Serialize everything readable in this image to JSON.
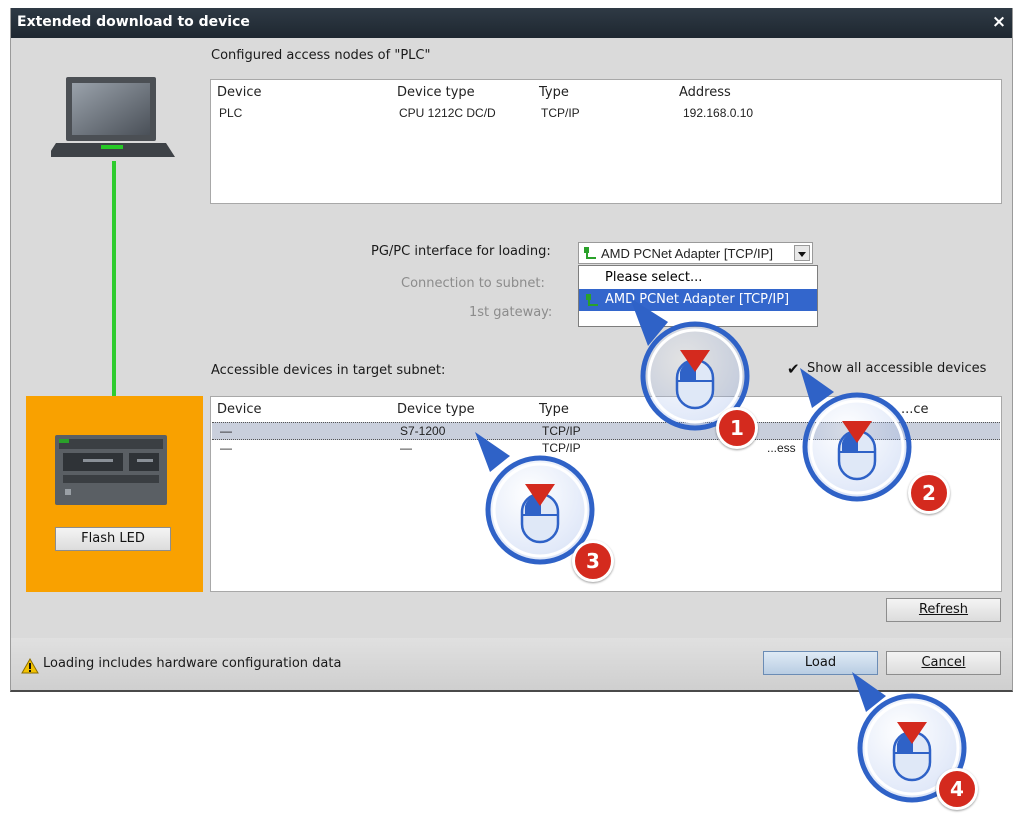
{
  "dialog": {
    "title": "Extended download to device",
    "close_glyph": "×"
  },
  "configured": {
    "heading": "Configured access nodes of \"PLC\"",
    "columns": [
      "Device",
      "Device type",
      "Type",
      "Address"
    ],
    "rows": [
      {
        "device": "PLC",
        "device_type": "CPU 1212C DC/D",
        "type": "TCP/IP",
        "address": "192.168.0.10"
      }
    ]
  },
  "interface": {
    "pgpc_label": "PG/PC interface for loading:",
    "subnet_label": "Connection to subnet:",
    "gateway_label": "1st gateway:",
    "selected": "AMD PCNet Adapter [TCP/IP]",
    "options": [
      "Please select...",
      "AMD PCNet Adapter [TCP/IP]"
    ]
  },
  "accessible": {
    "heading": "Accessible devices in target subnet:",
    "show_all_label": "Show all accessible devices",
    "show_all_checked": true,
    "columns": [
      "Device",
      "Device type",
      "Type",
      "...ce"
    ],
    "rows": [
      {
        "device": "—",
        "device_type": "S7-1200",
        "type": "TCP/IP",
        "address": ""
      },
      {
        "device": "—",
        "device_type": "—",
        "type": "TCP/IP",
        "address": "...ess"
      }
    ]
  },
  "left_panel": {
    "flash_led_label": "Flash LED"
  },
  "buttons": {
    "refresh": "Refresh",
    "load": "Load",
    "cancel": "Cancel"
  },
  "status": {
    "message": "Loading includes hardware configuration data",
    "icon": "warning-icon"
  },
  "callouts": [
    {
      "step": "1",
      "icon": "mouse-left-click-icon"
    },
    {
      "step": "2",
      "icon": "mouse-left-click-icon"
    },
    {
      "step": "3",
      "icon": "mouse-left-click-icon"
    },
    {
      "step": "4",
      "icon": "mouse-left-click-icon"
    }
  ],
  "colors": {
    "title_bar": "#1e2730",
    "highlight_orange": "#f9a100",
    "connection_line": "#2ecc2e",
    "selection_blue": "#3366cc",
    "callout_blue": "#2f62c7",
    "badge_red": "#d42a1e"
  }
}
